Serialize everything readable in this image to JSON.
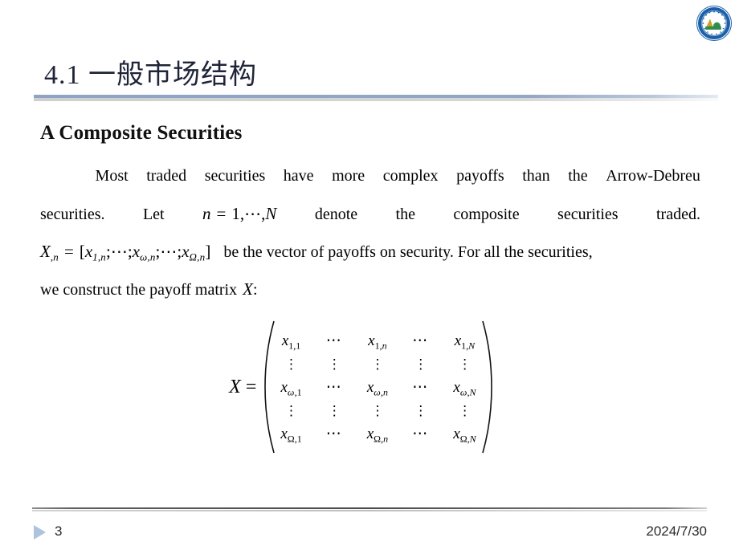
{
  "slide": {
    "title": "4.1  一般市场结构",
    "section_heading": "A Composite Securities"
  },
  "logo": {
    "name": "university-seal-logo",
    "ring_color": "#1a5fa8",
    "inner_color": "#2f8f4e",
    "accent_color": "#c9a227"
  },
  "body": {
    "line1": {
      "words": [
        "Most",
        "traded",
        "securities",
        "have",
        "more",
        "complex",
        "payoffs",
        "than",
        "the",
        "Arrow-Debreu"
      ]
    },
    "line2": {
      "lead": [
        "securities.",
        "Let"
      ],
      "math": {
        "var": "n",
        "eq": "=",
        "first": "1",
        "dots": ",⋯,",
        "last": "N"
      },
      "tail": [
        "denote",
        "the",
        "composite",
        "securities",
        "traded."
      ]
    },
    "line3": {
      "math_lhs": "X",
      "math_lhs_sub": ",n",
      "math_eq": "=",
      "math_open": "[",
      "math_terms": [
        {
          "base": "x",
          "sub": "1,n"
        },
        {
          "base": "x",
          "sub": "ω,n"
        },
        {
          "base": "x",
          "sub": "Ω,n"
        }
      ],
      "math_sep": ";⋯;",
      "math_close": "]",
      "text": "be the vector of payoffs on security. For all the securities,"
    },
    "line4": {
      "text_before": "we construct the payoff matrix",
      "math_var": "X",
      "text_after": ":"
    }
  },
  "matrix": {
    "lhs": "X",
    "equals": "=",
    "open_delim": "(",
    "close_delim": ")",
    "rows": [
      [
        {
          "type": "entry",
          "base": "x",
          "sub_row": "1",
          "sub_col": "1"
        },
        {
          "type": "hdots",
          "text": "⋯"
        },
        {
          "type": "entry",
          "base": "x",
          "sub_row": "1",
          "sub_col": "n"
        },
        {
          "type": "hdots",
          "text": "⋯"
        },
        {
          "type": "entry",
          "base": "x",
          "sub_row": "1",
          "sub_col": "N"
        }
      ],
      [
        {
          "type": "vdots",
          "text": "⋮"
        },
        {
          "type": "vdots",
          "text": "⋮"
        },
        {
          "type": "vdots",
          "text": "⋮"
        },
        {
          "type": "vdots",
          "text": "⋮"
        },
        {
          "type": "vdots",
          "text": "⋮"
        }
      ],
      [
        {
          "type": "entry",
          "base": "x",
          "sub_row": "ω",
          "sub_col": "1"
        },
        {
          "type": "hdots",
          "text": "⋯"
        },
        {
          "type": "entry",
          "base": "x",
          "sub_row": "ω",
          "sub_col": "n"
        },
        {
          "type": "hdots",
          "text": "⋯"
        },
        {
          "type": "entry",
          "base": "x",
          "sub_row": "ω",
          "sub_col": "N"
        }
      ],
      [
        {
          "type": "vdots",
          "text": "⋮"
        },
        {
          "type": "vdots",
          "text": "⋮"
        },
        {
          "type": "vdots",
          "text": "⋮"
        },
        {
          "type": "vdots",
          "text": "⋮"
        },
        {
          "type": "vdots",
          "text": "⋮"
        }
      ],
      [
        {
          "type": "entry",
          "base": "x",
          "sub_row": "Ω",
          "sub_col": "1"
        },
        {
          "type": "hdots",
          "text": "⋯"
        },
        {
          "type": "entry",
          "base": "x",
          "sub_row": "Ω",
          "sub_col": "n"
        },
        {
          "type": "hdots",
          "text": "⋯"
        },
        {
          "type": "entry",
          "base": "x",
          "sub_row": "Ω",
          "sub_col": "N"
        }
      ]
    ]
  },
  "footer": {
    "page_number": "3",
    "date": "2024/7/30",
    "triangle_color": "#aec3dd"
  }
}
